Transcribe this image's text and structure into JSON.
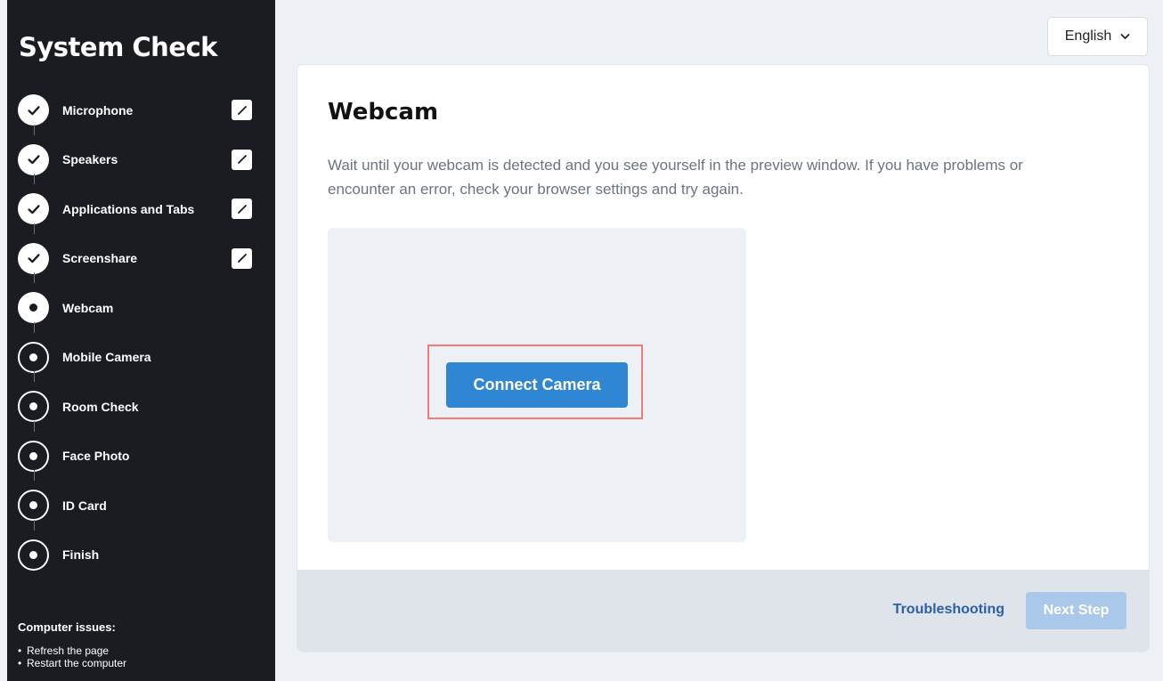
{
  "sidebar": {
    "title": "System Check",
    "steps": [
      {
        "label": "Microphone",
        "status": "done"
      },
      {
        "label": "Speakers",
        "status": "done"
      },
      {
        "label": "Applications and Tabs",
        "status": "done"
      },
      {
        "label": "Screenshare",
        "status": "done"
      },
      {
        "label": "Webcam",
        "status": "current"
      },
      {
        "label": "Mobile Camera",
        "status": "pending"
      },
      {
        "label": "Room Check",
        "status": "pending"
      },
      {
        "label": "Face Photo",
        "status": "pending"
      },
      {
        "label": "ID Card",
        "status": "pending"
      },
      {
        "label": "Finish",
        "status": "pending"
      }
    ],
    "issues": {
      "title": "Computer issues:",
      "items": [
        "Refresh the page",
        "Restart the computer"
      ]
    }
  },
  "language": {
    "selected": "English"
  },
  "main": {
    "title": "Webcam",
    "description": "Wait until your webcam is detected and you see yourself in the preview window. If you have problems or encounter an error, check your browser settings and try again.",
    "connect_button": "Connect Camera",
    "troubleshooting_link": "Troubleshooting",
    "next_button": "Next Step"
  },
  "colors": {
    "sidebar_bg": "#1a1c22",
    "primary": "#2f86d3",
    "highlight": "#ef7f76",
    "link": "#2e5ea8",
    "disabled": "#a9c8ea"
  }
}
